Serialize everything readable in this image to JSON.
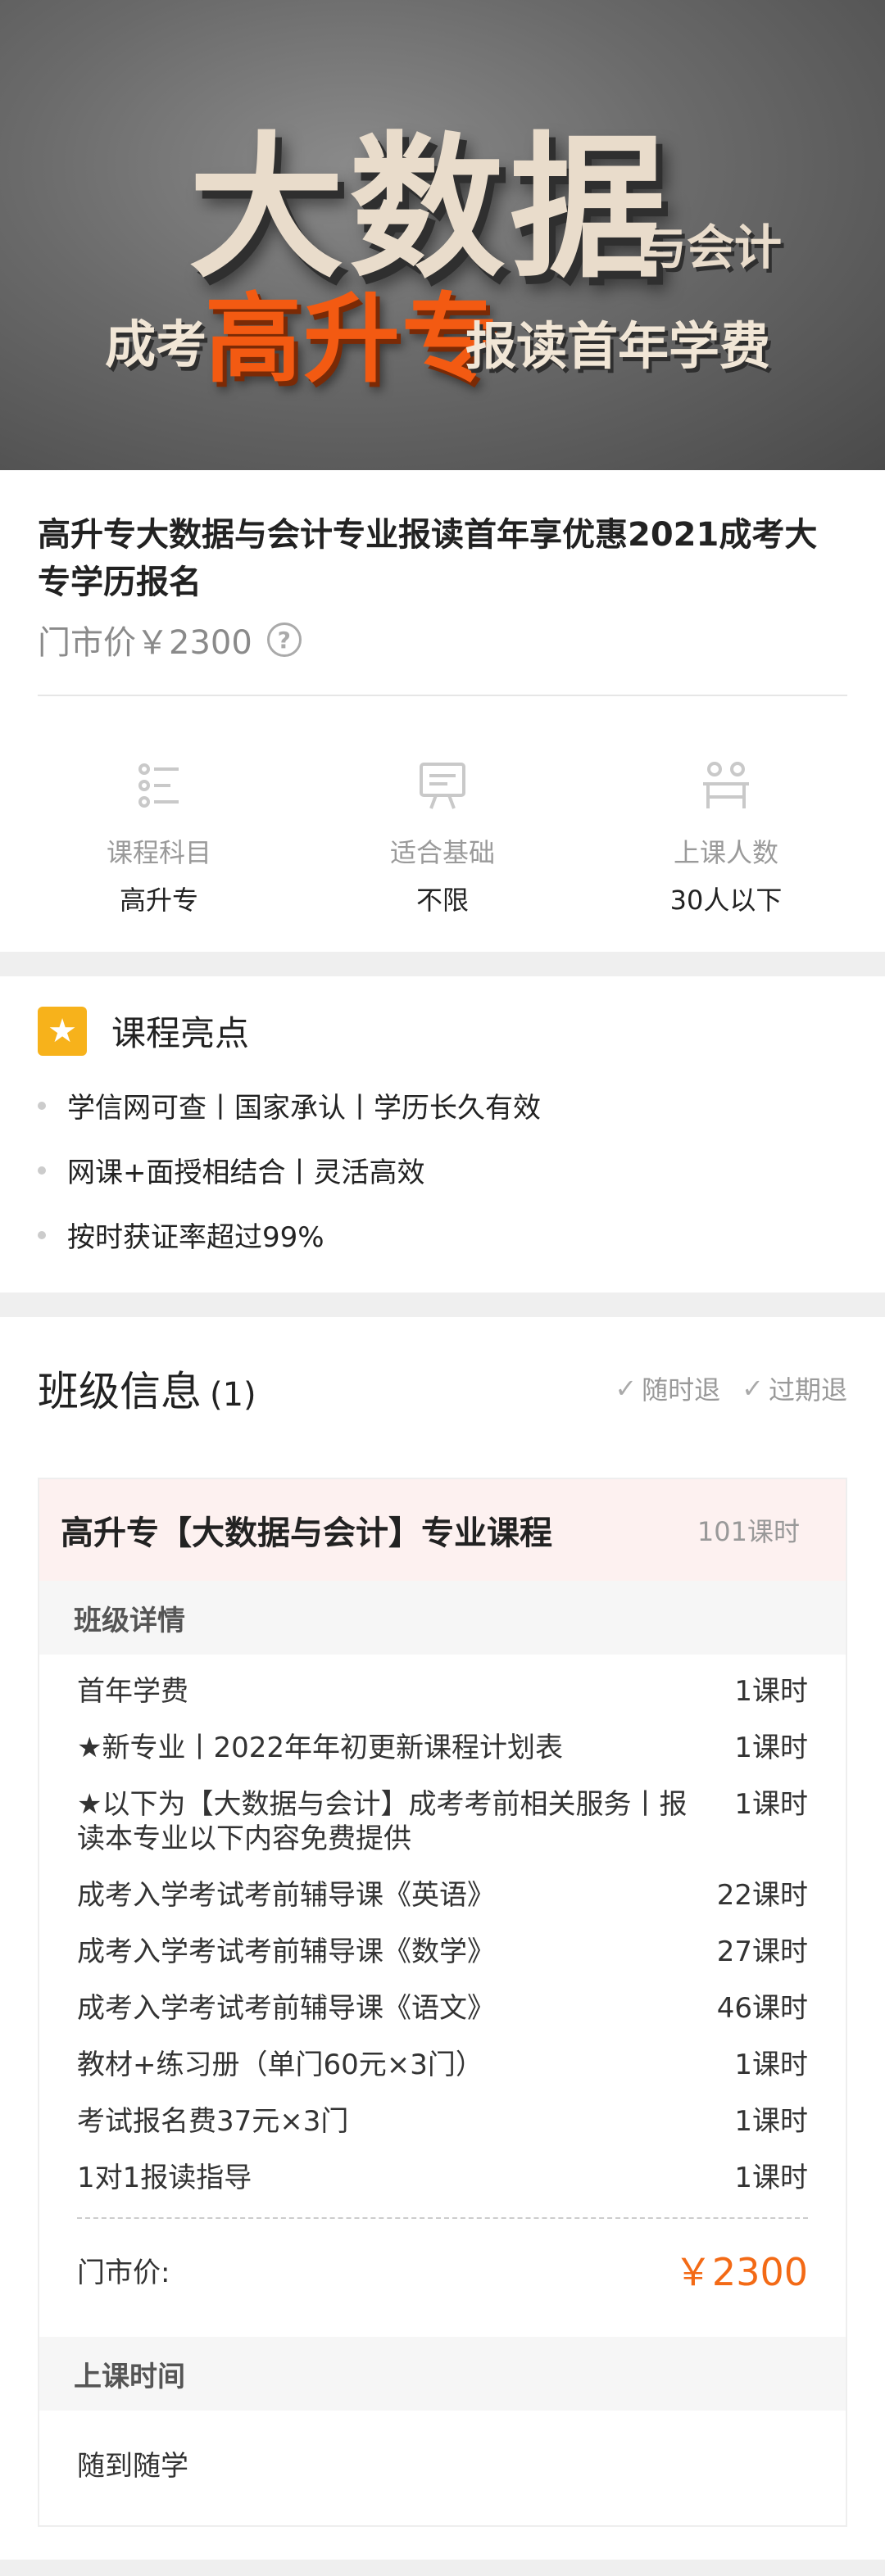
{
  "hero": {
    "big": "大数据",
    "small": "与会计",
    "left": "成考",
    "orange": "高升专",
    "right": "报读首年学费"
  },
  "product": {
    "title": "高升专大数据与会计专业报读首年享优惠2021成考大专学历报名",
    "price": "门市价￥2300",
    "help_icon": "?"
  },
  "stats": [
    {
      "icon": "list-icon",
      "label": "课程科目",
      "value": "高升专"
    },
    {
      "icon": "board-icon",
      "label": "适合基础",
      "value": "不限"
    },
    {
      "icon": "people-icon",
      "label": "上课人数",
      "value": "30人以下"
    }
  ],
  "highlights": {
    "title": "课程亮点",
    "items": [
      "学信网可查丨国家承认丨学历长久有效",
      "网课+面授相结合丨灵活高效",
      "按时获证率超过99%"
    ]
  },
  "class_info": {
    "title": "班级信息",
    "count": "(1)",
    "tags": [
      "随时退",
      "过期退"
    ],
    "course": {
      "name": "高升专【大数据与会计】专业课程",
      "hours": "101课时",
      "details_label": "班级详情",
      "items": [
        {
          "name": "首年学费",
          "hours": "1课时"
        },
        {
          "name": "★新专业丨2022年年初更新课程计划表",
          "hours": "1课时"
        },
        {
          "name": "★以下为【大数据与会计】成考考前相关服务丨报读本专业以下内容免费提供",
          "hours": "1课时"
        },
        {
          "name": "成考入学考试考前辅导课《英语》",
          "hours": "22课时"
        },
        {
          "name": "成考入学考试考前辅导课《数学》",
          "hours": "27课时"
        },
        {
          "name": "成考入学考试考前辅导课《语文》",
          "hours": "46课时"
        },
        {
          "name": "教材+练习册（单门60元×3门）",
          "hours": "1课时"
        },
        {
          "name": "考试报名费37元×3门",
          "hours": "1课时"
        },
        {
          "name": "1对1报读指导",
          "hours": "1课时"
        }
      ],
      "total_label": "门市价:",
      "total_amount": "￥2300",
      "time_label": "上课时间",
      "time_value": "随到随学"
    }
  },
  "colors": {
    "accent_orange": "#f36a16",
    "star_yellow": "#f7b21b",
    "course_header_bg": "#fdf1f0"
  }
}
